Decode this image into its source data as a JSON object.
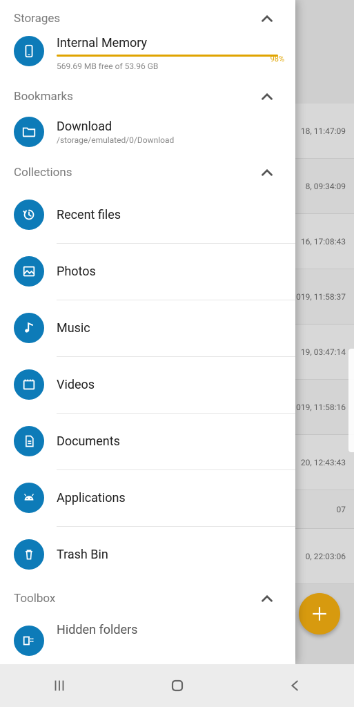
{
  "sections": {
    "storages": {
      "title": "Storages"
    },
    "bookmarks": {
      "title": "Bookmarks"
    },
    "collections": {
      "title": "Collections"
    },
    "toolbox": {
      "title": "Toolbox"
    }
  },
  "storage": {
    "title": "Internal Memory",
    "free_label": "569.69 MB free of 53.96 GB",
    "percent_label": "98%",
    "percent_value": 98
  },
  "bookmark": {
    "title": "Download",
    "path": "/storage/emulated/0/Download"
  },
  "collections": [
    {
      "label": "Recent files",
      "icon": "recent"
    },
    {
      "label": "Photos",
      "icon": "photo"
    },
    {
      "label": "Music",
      "icon": "music"
    },
    {
      "label": "Videos",
      "icon": "video"
    },
    {
      "label": "Documents",
      "icon": "doc"
    },
    {
      "label": "Applications",
      "icon": "android"
    },
    {
      "label": "Trash Bin",
      "icon": "trash"
    }
  ],
  "toolbox_items": [
    {
      "label": "Hidden folders",
      "icon": "hidden"
    }
  ],
  "background_rows": [
    "18, 11:47:09",
    "8, 09:34:09",
    "16, 17:08:43",
    "019, 11:58:37",
    "19, 03:47:14",
    "019, 11:58:16",
    "20, 12:43:43",
    "07",
    "0, 22:03:06"
  ],
  "colors": {
    "accent": "#0d7bb8",
    "progress": "#e0a400",
    "fab": "#d79a0f"
  }
}
